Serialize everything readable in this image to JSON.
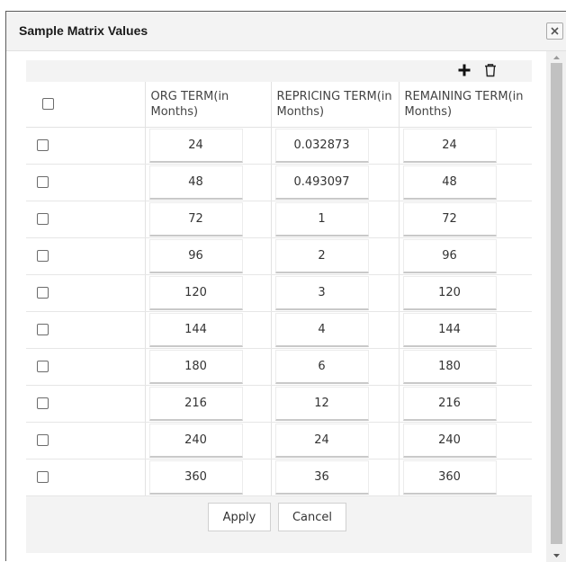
{
  "dialog": {
    "title": "Sample Matrix Values",
    "close_icon": "close-icon"
  },
  "toolbar": {
    "add_icon": "plus-icon",
    "delete_icon": "trash-icon"
  },
  "table": {
    "headers": [
      "ORG TERM(in Months)",
      "REPRICING TERM(in Months)",
      "REMAINING TERM(in Months)"
    ],
    "rows": [
      {
        "org": "24",
        "repricing": "0.032873",
        "remaining": "24"
      },
      {
        "org": "48",
        "repricing": "0.493097",
        "remaining": "48"
      },
      {
        "org": "72",
        "repricing": "1",
        "remaining": "72"
      },
      {
        "org": "96",
        "repricing": "2",
        "remaining": "96"
      },
      {
        "org": "120",
        "repricing": "3",
        "remaining": "120"
      },
      {
        "org": "144",
        "repricing": "4",
        "remaining": "144"
      },
      {
        "org": "180",
        "repricing": "6",
        "remaining": "180"
      },
      {
        "org": "216",
        "repricing": "12",
        "remaining": "216"
      },
      {
        "org": "240",
        "repricing": "24",
        "remaining": "240"
      },
      {
        "org": "360",
        "repricing": "36",
        "remaining": "360"
      }
    ]
  },
  "buttons": {
    "apply_label": "Apply",
    "cancel_label": "Cancel"
  },
  "colors": {
    "panel_bg": "#f3f3f3",
    "border": "#5c5c5c",
    "scroll_thumb": "#c1c1c1"
  }
}
